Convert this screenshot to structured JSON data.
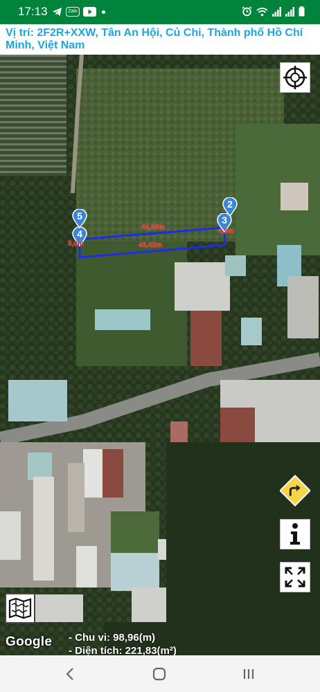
{
  "status_bar": {
    "time": "17:13",
    "left_icons": [
      "telegram-icon",
      "zalo-icon",
      "youtube-icon",
      "notification-dot"
    ],
    "right_icons": [
      "alarm-icon",
      "wifi-icon",
      "signal-icon",
      "signal-icon",
      "battery-icon"
    ],
    "zalo_label": "Zalo"
  },
  "location": {
    "text": "Vị trí: 2F2R+XXW, Tân An Hội, Củ Chi, Thành phố Hồ Chí Minh, Việt Nam"
  },
  "map": {
    "provider": "Google",
    "polygon_color": "#1a2ee6",
    "pin_color": "#3a86d6",
    "markers": [
      {
        "label": "2"
      },
      {
        "label": "3"
      },
      {
        "label": "4"
      },
      {
        "label": "5"
      }
    ],
    "segments": [
      {
        "text": "44,99m"
      },
      {
        "text": "43,42m"
      },
      {
        "text": "5,0m"
      },
      {
        "text": "4,9m"
      }
    ]
  },
  "stats": {
    "perimeter": "- Chu vi: 98,96(m)",
    "area": "- Diện tích: 221,83(m²)"
  },
  "controls": {
    "gps": "crosshair-icon",
    "route": "turn-right-icon",
    "info": "info-icon",
    "fullscreen": "expand-icon",
    "map_type": "map-icon"
  }
}
